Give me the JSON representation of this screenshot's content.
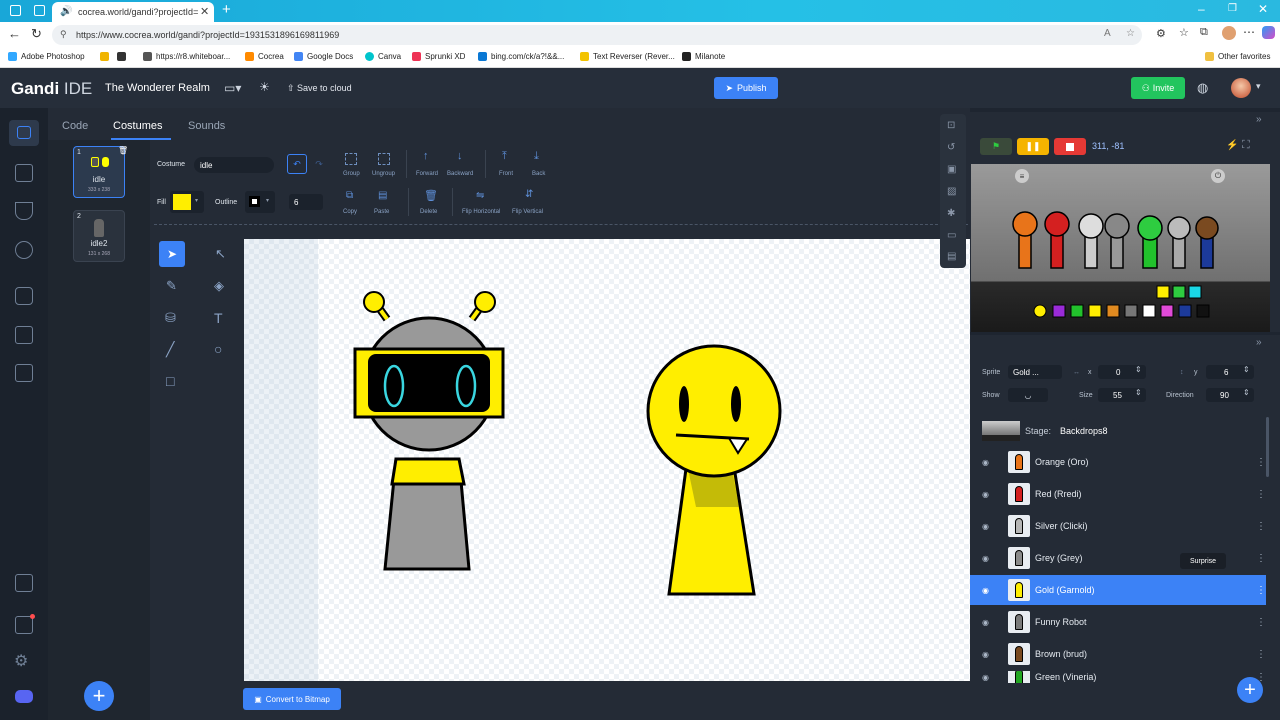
{
  "browser": {
    "tab_title": "cocrea.world/gandi?projectId=",
    "url": "https://www.cocrea.world/gandi?projectId=1931531896169811969",
    "favorites": [
      "Adobe Photoshop",
      "https://r8.whiteboar...",
      "Cocrea",
      "Google Docs",
      "Canva",
      "Sprunki XD",
      "bing.com/ck/a?!&&...",
      "Text Reverser (Rever...",
      "Milanote"
    ],
    "other_favorites": "Other favorites"
  },
  "header": {
    "logo_main": "Gandi",
    "logo_sub": "IDE",
    "project_name": "The Wonderer Realm",
    "save_label": "Save to cloud",
    "publish_label": "Publish",
    "invite_label": "Invite"
  },
  "editor_tabs": [
    "Code",
    "Costumes",
    "Sounds"
  ],
  "costumes": [
    {
      "index": "1",
      "name": "idle",
      "size": "333 x 238"
    },
    {
      "index": "2",
      "name": "idle2",
      "size": "131 x 268"
    }
  ],
  "paint_toolbar": {
    "costume_label": "Costume",
    "costume_name": "idle",
    "fill_label": "Fill",
    "fill_color": "#ffee00",
    "outline_label": "Outline",
    "outline_color": "#000000",
    "outline_width": "6",
    "group": "Group",
    "ungroup": "Ungroup",
    "forward": "Forward",
    "backward": "Backward",
    "front": "Front",
    "back": "Back",
    "copy": "Copy",
    "paste": "Paste",
    "delete": "Delete",
    "flip_h": "Flip Horizontal",
    "flip_v": "Flip Vertical"
  },
  "convert_label": "Convert to Bitmap",
  "stage_header": {
    "coords": "311, -81"
  },
  "sprite_info": {
    "sprite_label": "Sprite",
    "sprite_name": "Gold ...",
    "x_label": "x",
    "x_value": "0",
    "y_label": "y",
    "y_value": "6",
    "show_label": "Show",
    "size_label": "Size",
    "size_value": "55",
    "direction_label": "Direction",
    "direction_value": "90"
  },
  "stage_row": {
    "label": "Stage:",
    "backdrop": "Backdrops8"
  },
  "sprites": [
    {
      "name": "Orange (Oro)",
      "color": "#e8741a",
      "selected": false
    },
    {
      "name": "Red (Rredi)",
      "color": "#d42020",
      "selected": false
    },
    {
      "name": "Silver (Clicki)",
      "color": "#b5b5b5",
      "selected": false
    },
    {
      "name": "Grey (Grey)",
      "color": "#8a8a8a",
      "selected": false
    },
    {
      "name": "Gold (Garnold)",
      "color": "#ffee00",
      "selected": true
    },
    {
      "name": "Funny Robot",
      "color": "#7a7a7a",
      "selected": false
    },
    {
      "name": "Brown (brud)",
      "color": "#7a4a20",
      "selected": false
    },
    {
      "name": "Green (Vineria)",
      "color": "#22a622",
      "selected": false
    }
  ],
  "tooltip": "Surprise",
  "colors": {
    "accent": "#3c82f6",
    "invite": "#22c55e",
    "gold": "#ffee00"
  }
}
